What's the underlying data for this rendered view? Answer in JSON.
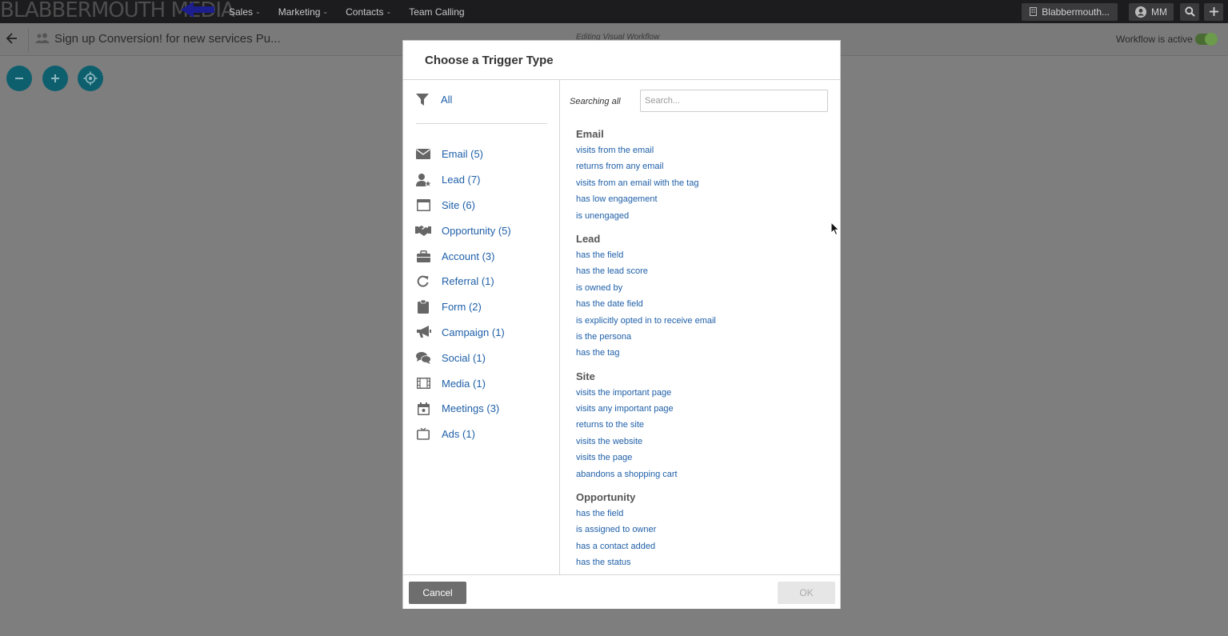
{
  "topnav": {
    "logo_text": "BLABBERMOUTH MEDIA",
    "menu": [
      {
        "label": "Sales"
      },
      {
        "label": "Marketing"
      },
      {
        "label": "Contacts"
      },
      {
        "label": "Team Calling"
      }
    ],
    "account_label": "Blabbermouth...",
    "user_initials": "MM",
    "icons": [
      "building-icon",
      "user-circle-icon",
      "search-icon",
      "plus-icon"
    ]
  },
  "subheader": {
    "workflow_title": "Sign up Conversion! for new services Pu...",
    "editing_label": "Editing Visual Workflow",
    "active_label": "Workflow is active",
    "active": true
  },
  "canvas_controls": [
    "zoom-out",
    "zoom-in",
    "recenter"
  ],
  "modal": {
    "title": "Choose a Trigger Type",
    "all_label": "All",
    "categories": [
      {
        "label": "Email (5)",
        "icon": "envelope-icon"
      },
      {
        "label": "Lead (7)",
        "icon": "user-star-icon"
      },
      {
        "label": "Site (6)",
        "icon": "browser-icon"
      },
      {
        "label": "Opportunity (5)",
        "icon": "handshake-icon"
      },
      {
        "label": "Account (3)",
        "icon": "briefcase-icon"
      },
      {
        "label": "Referral (1)",
        "icon": "refresh-icon"
      },
      {
        "label": "Form (2)",
        "icon": "clipboard-icon"
      },
      {
        "label": "Campaign (1)",
        "icon": "megaphone-icon"
      },
      {
        "label": "Social (1)",
        "icon": "chat-bubbles-icon"
      },
      {
        "label": "Media (1)",
        "icon": "film-icon"
      },
      {
        "label": "Meetings (3)",
        "icon": "calendar-icon"
      },
      {
        "label": "Ads (1)",
        "icon": "tv-icon"
      }
    ],
    "search_label": "Searching all",
    "search_placeholder": "Search...",
    "trigger_groups": [
      {
        "title": "Email",
        "items": [
          "visits from the email",
          "returns from any email",
          "visits from an email with the tag",
          "has low engagement",
          "is unengaged"
        ]
      },
      {
        "title": "Lead",
        "items": [
          "has the field",
          "has the lead score",
          "is owned by",
          "has the date field",
          "is explicitly opted in to receive email",
          "is the persona",
          "has the tag"
        ]
      },
      {
        "title": "Site",
        "items": [
          "visits the important page",
          "visits any important page",
          "returns to the site",
          "visits the website",
          "visits the page",
          "abandons a shopping cart"
        ]
      },
      {
        "title": "Opportunity",
        "items": [
          "has the field",
          "is assigned to owner",
          "has a contact added",
          "has the status"
        ]
      }
    ],
    "cancel_label": "Cancel",
    "ok_label": "OK"
  },
  "colors": {
    "link": "#1e5fa8",
    "nav_bg": "#1c1c1e",
    "overlay_bg": "#7e7e7e",
    "canvas_button": "#0e5f6e",
    "toggle_on": "#6b9b4b"
  }
}
